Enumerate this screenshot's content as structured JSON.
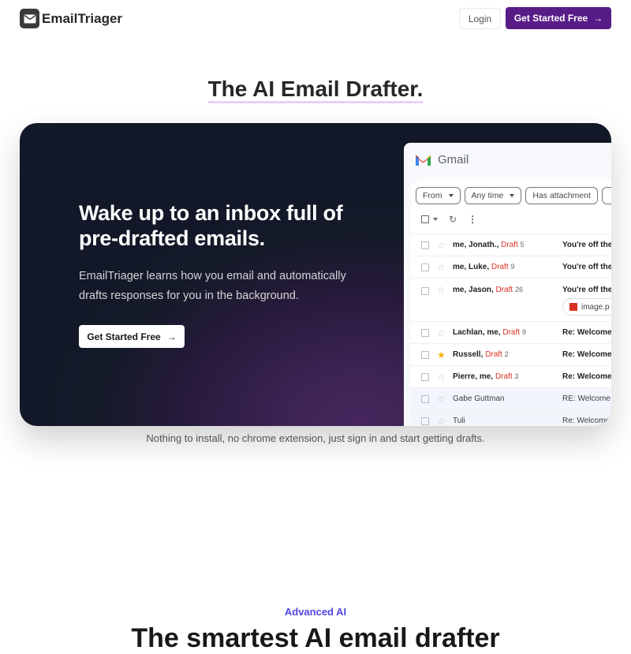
{
  "nav": {
    "brand": "EmailTriager",
    "login_label": "Login",
    "cta_label": "Get Started Free",
    "cta_color": "#581c87"
  },
  "hero": {
    "title": "The AI Email Drafter."
  },
  "card": {
    "headline": "Wake up to an inbox full of pre-drafted emails.",
    "description": "EmailTriager learns how you email and automatically drafts responses for you in the background.",
    "cta_label": "Get Started Free"
  },
  "gmail": {
    "app_name": "Gmail",
    "filters": [
      "From",
      "Any time",
      "Has attachment"
    ],
    "rows": [
      {
        "sender": "me, Jonath.,",
        "draft": "Draft",
        "count": "5",
        "subject": "You're off the",
        "starred": false,
        "read": false
      },
      {
        "sender": "me, Luke,",
        "draft": "Draft",
        "count": "9",
        "subject": "You're off the",
        "starred": false,
        "read": false
      },
      {
        "sender": "me, Jason,",
        "draft": "Draft",
        "count": "26",
        "subject": "You're off the",
        "starred": false,
        "read": false,
        "attachment": "image.p"
      },
      {
        "sender": "Lachlan, me,",
        "draft": "Draft",
        "count": "9",
        "subject": "Re: Welcome",
        "starred": false,
        "read": false
      },
      {
        "sender": "Russell,",
        "draft": "Draft",
        "count": "2",
        "subject": "Re: Welcome",
        "starred": true,
        "read": false
      },
      {
        "sender": "Pierre, me,",
        "draft": "Draft",
        "count": "3",
        "subject": "Re: Welcome",
        "starred": false,
        "read": false
      },
      {
        "sender": "Gabe Guttman",
        "draft": "",
        "count": "",
        "subject": "RE: Welcome t",
        "starred": false,
        "read": true
      },
      {
        "sender": "Tuli",
        "draft": "",
        "count": "",
        "subject": "Re: Welcome",
        "starred": false,
        "read": true
      }
    ]
  },
  "subtext": "Nothing to install, no chrome extension, just sign in and start getting drafts.",
  "section": {
    "eyebrow": "Advanced AI",
    "title": "The smartest AI email drafter"
  }
}
